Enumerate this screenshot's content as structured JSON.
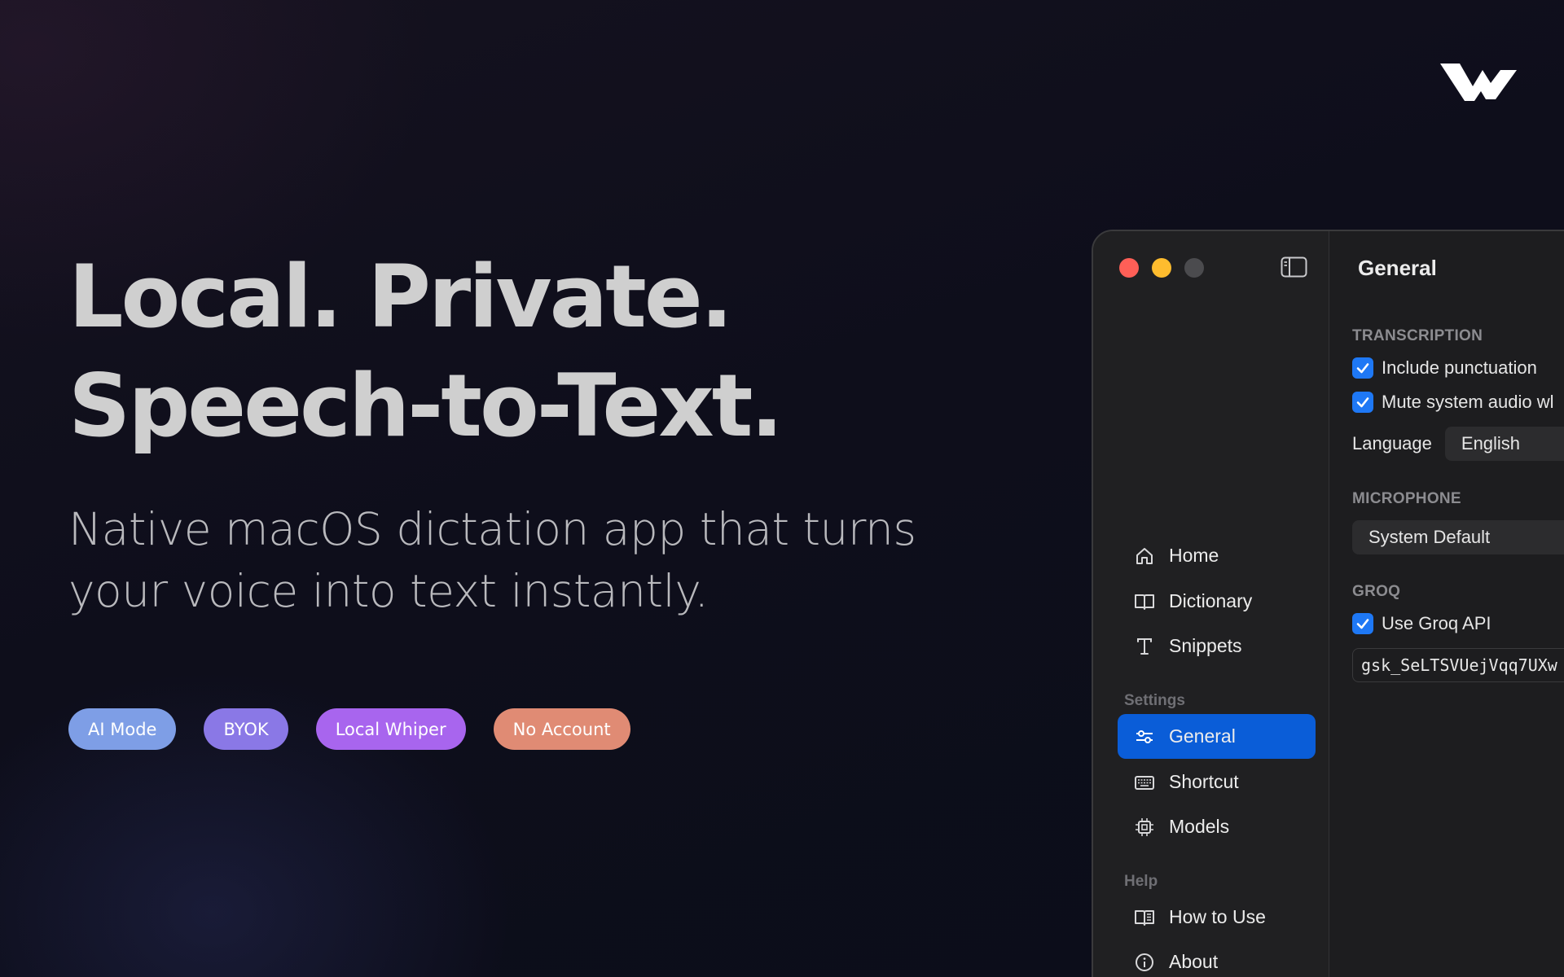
{
  "hero": {
    "headline_line1": "Local. Private.",
    "headline_line2": "Speech-to-Text.",
    "subtitle": "Native macOS dictation app that turns your voice into text instantly."
  },
  "badges": [
    {
      "label": "AI Mode",
      "color": "#7e9ee6"
    },
    {
      "label": "BYOK",
      "color": "#8a78e6"
    },
    {
      "label": "Local Whiper",
      "color": "#a865ee"
    },
    {
      "label": "No Account",
      "color": "#e08b74"
    }
  ],
  "app": {
    "traffic_lights": {
      "close": "#ff5f57",
      "minimize": "#febc2e",
      "zoom": "#4b4b4e"
    },
    "sidebar": {
      "items": [
        {
          "label": "Home",
          "icon": "house-icon"
        },
        {
          "label": "Dictionary",
          "icon": "book-icon"
        },
        {
          "label": "Snippets",
          "icon": "text-t-icon"
        }
      ],
      "settings_label": "Settings",
      "settings_items": [
        {
          "label": "General",
          "icon": "sliders-icon",
          "active": true
        },
        {
          "label": "Shortcut",
          "icon": "keyboard-icon"
        },
        {
          "label": "Models",
          "icon": "cpu-icon"
        }
      ],
      "help_label": "Help",
      "help_items": [
        {
          "label": "How to Use",
          "icon": "open-book-icon"
        },
        {
          "label": "About",
          "icon": "info-icon"
        }
      ]
    },
    "content": {
      "title": "General",
      "transcription_label": "TRANSCRIPTION",
      "include_punctuation": {
        "label": "Include punctuation",
        "checked": true
      },
      "mute_system_audio": {
        "label": "Mute system audio wl",
        "checked": true
      },
      "language_label": "Language",
      "language_value": "English",
      "microphone_label": "MICROPHONE",
      "microphone_value": "System Default",
      "groq_label": "GROQ",
      "use_groq": {
        "label": "Use Groq API",
        "checked": true
      },
      "api_key_value": "gsk_SeLTSVUejVqq7UXw"
    },
    "accent": "#0a5dd8"
  }
}
